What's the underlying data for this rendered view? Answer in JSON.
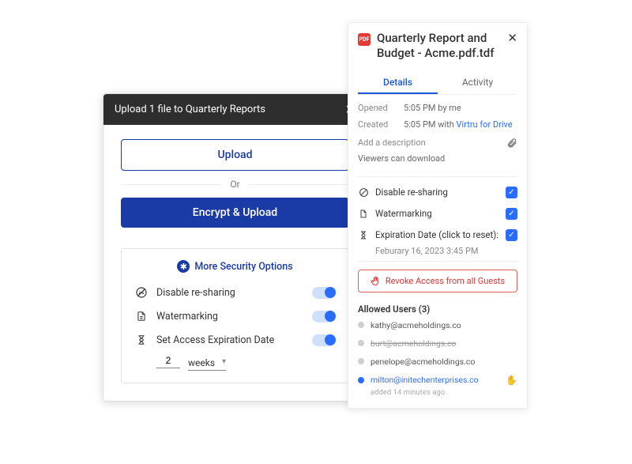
{
  "upload": {
    "title": "Upload 1 file to Quarterly Reports",
    "upload_label": "Upload",
    "or": "Or",
    "encrypt_label": "Encrypt & Upload",
    "more_security": "More Security Options",
    "options": {
      "disable_resharing": "Disable re-sharing",
      "watermarking": "Watermarking",
      "expiration": "Set Access Expiration Date"
    },
    "exp_value": "2",
    "exp_unit": "weeks"
  },
  "details": {
    "filename": "Quarterly Report and Budget - Acme.pdf.tdf",
    "tabs": {
      "details": "Details",
      "activity": "Activity"
    },
    "opened_label": "Opened",
    "opened_value": "5:05 PM by me",
    "created_label": "Created",
    "created_time": "5:05 PM with ",
    "created_app": "Virtru for Drive",
    "add_desc": "Add a description",
    "viewers_can_download": "Viewers can download",
    "opts": {
      "disable_resharing": "Disable re-sharing",
      "watermarking": "Watermarking",
      "expiration": "Expiration Date (click to reset):"
    },
    "exp_date": "Feburary 16, 2023 3:45 PM",
    "revoke": "Revoke Access from all Guests",
    "allowed_label": "Allowed Users (3)",
    "users": [
      {
        "email": "kathy@acmeholdings.co",
        "state": "normal"
      },
      {
        "email": "burt@acmeholdings.co",
        "state": "revoked"
      },
      {
        "email": "penelope@acmeholdings.co",
        "state": "normal"
      },
      {
        "email": "milton@initechenterprises.co",
        "state": "active",
        "added": "added 14 minutes ago"
      }
    ]
  }
}
